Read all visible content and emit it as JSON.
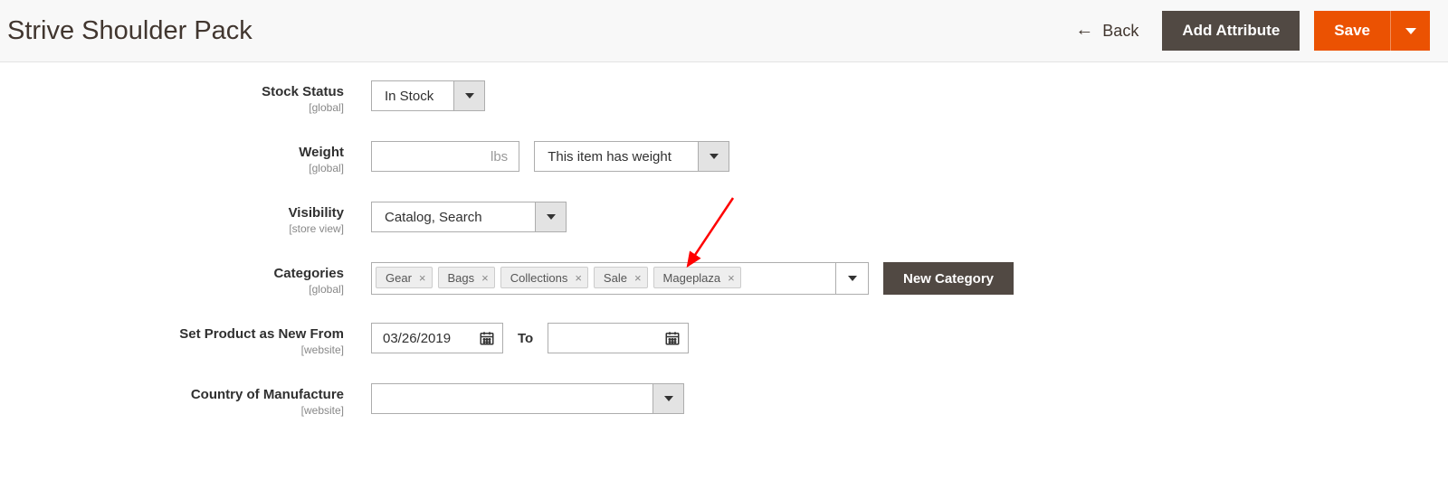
{
  "header": {
    "title": "Strive Shoulder Pack",
    "back_label": "Back",
    "add_attribute_label": "Add Attribute",
    "save_label": "Save"
  },
  "fields": {
    "stock_status": {
      "label": "Stock Status",
      "scope": "[global]",
      "value": "In Stock"
    },
    "weight": {
      "label": "Weight",
      "scope": "[global]",
      "unit": "lbs",
      "has_weight_value": "This item has weight"
    },
    "visibility": {
      "label": "Visibility",
      "scope": "[store view]",
      "value": "Catalog, Search"
    },
    "categories": {
      "label": "Categories",
      "scope": "[global]",
      "chips": [
        "Gear",
        "Bags",
        "Collections",
        "Sale",
        "Mageplaza"
      ],
      "new_button": "New Category"
    },
    "set_new_from": {
      "label": "Set Product as New From",
      "scope": "[website]",
      "from_value": "03/26/2019",
      "to_label": "To",
      "to_value": ""
    },
    "country": {
      "label": "Country of Manufacture",
      "scope": "[website]",
      "value": ""
    }
  }
}
